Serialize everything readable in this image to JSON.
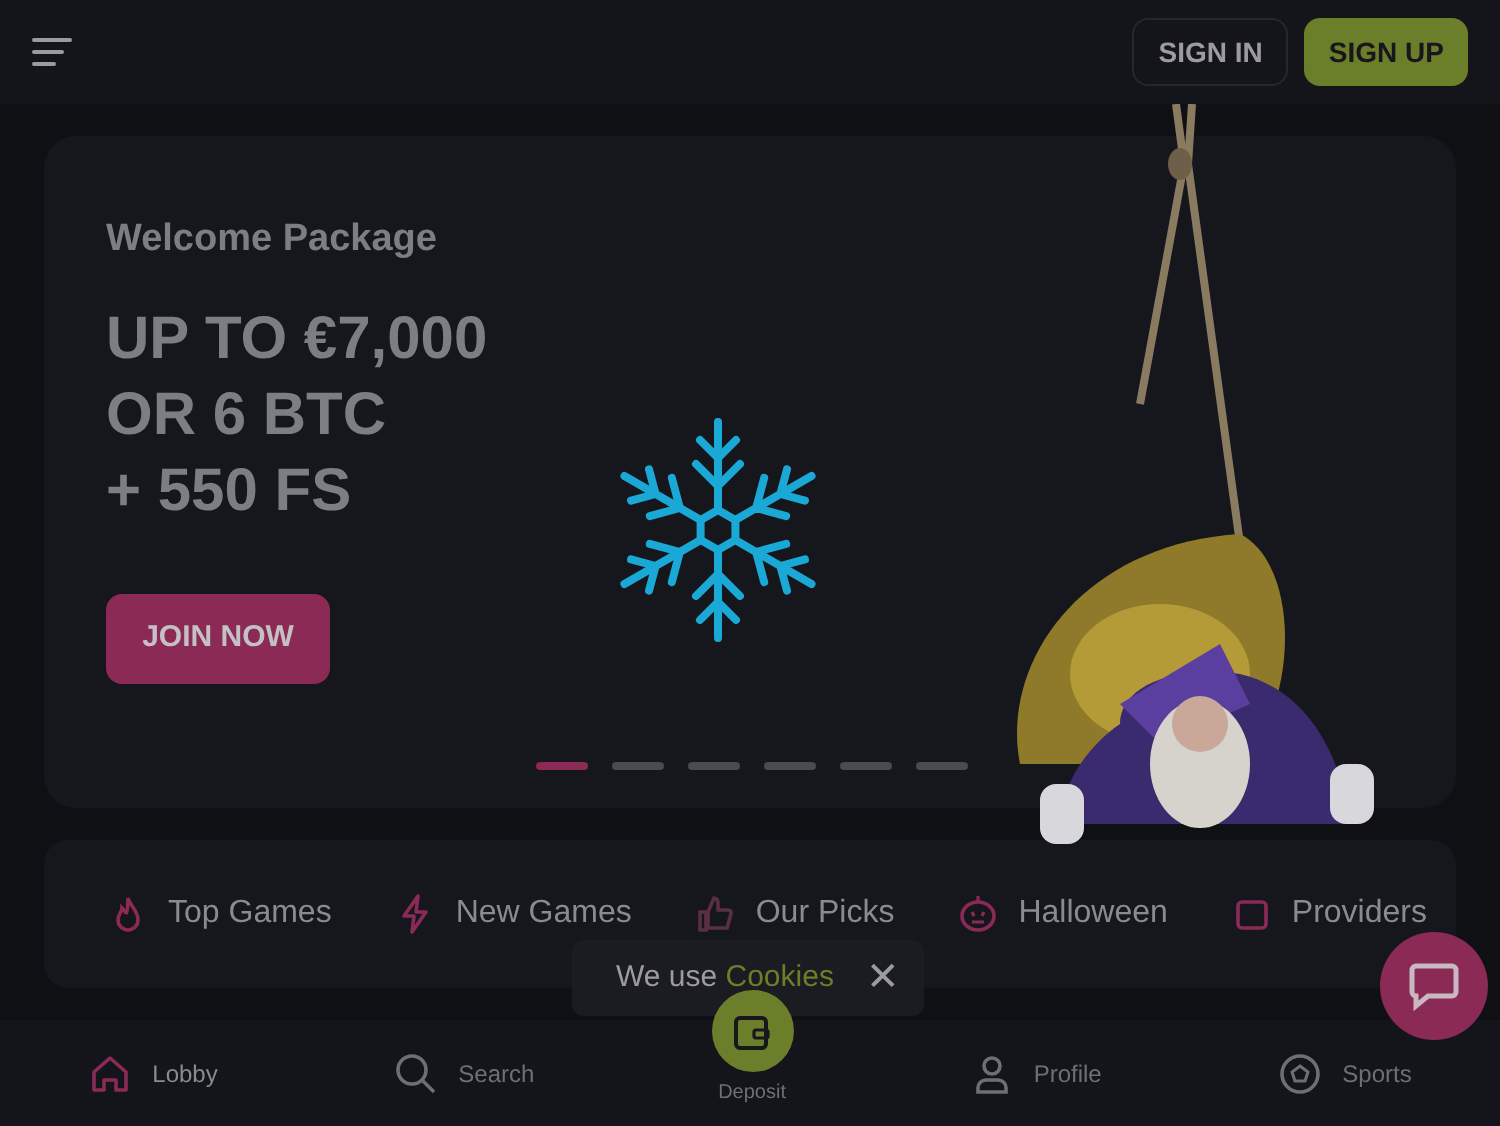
{
  "header": {
    "buttons": [
      {
        "label": "SIGN IN",
        "kind": "outline"
      },
      {
        "label": "SIGN UP",
        "kind": "primary"
      }
    ]
  },
  "banner": {
    "subtitle": "Welcome Package",
    "headline": [
      "UP TO €7,000",
      "OR 6 BTC",
      "+ 550 FS"
    ],
    "cta": "JOIN NOW",
    "slides": [
      {
        "selected": true
      },
      {
        "selected": false
      },
      {
        "selected": false
      },
      {
        "selected": false
      },
      {
        "selected": false
      },
      {
        "selected": false
      }
    ]
  },
  "categories": [
    {
      "label": "Top Games"
    },
    {
      "label": "New Games"
    },
    {
      "label": "Our Picks"
    },
    {
      "label": "Halloween"
    },
    {
      "label": "Providers"
    }
  ],
  "cookie": {
    "text": "We use ",
    "link": "Cookies",
    "close": "✕"
  },
  "nav": [
    {
      "label": "Lobby",
      "selected": true,
      "kind": "tab"
    },
    {
      "label": "Search",
      "selected": false,
      "kind": "tab"
    },
    {
      "label": "Deposit",
      "selected": false,
      "kind": "center"
    },
    {
      "label": "Profile",
      "selected": false,
      "kind": "tab"
    },
    {
      "label": "Sports",
      "selected": false,
      "kind": "tab"
    }
  ]
}
